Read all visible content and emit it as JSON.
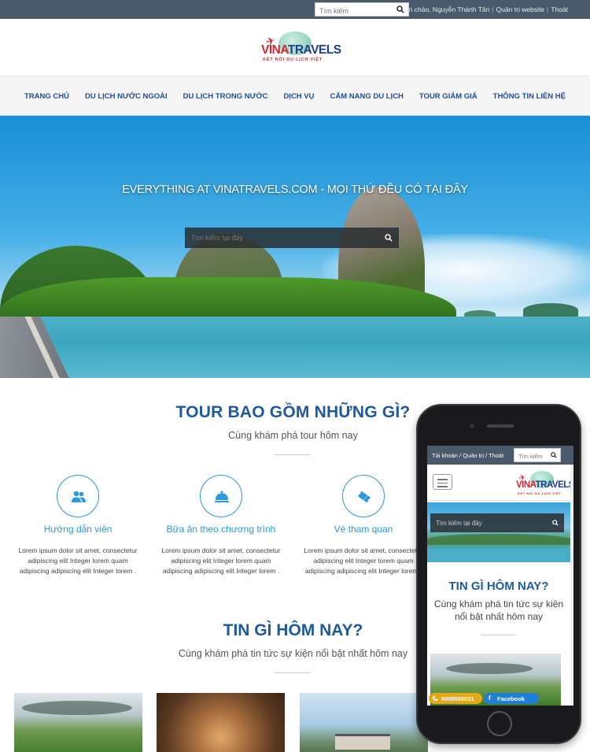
{
  "topbar": {
    "search_placeholder": "Tìm kiếm",
    "greeting": "Xin chào, Nguyễn Thành Tân",
    "admin_link": "Quản trị website",
    "logout_link": "Thoát"
  },
  "logo": {
    "brand_part1": "VINA",
    "brand_part2": "TRAVELS",
    "tagline": "KẾT NỐI DU LỊCH VIỆT"
  },
  "nav": {
    "items": [
      "TRANG CHỦ",
      "DU LỊCH NƯỚC NGOÀI",
      "DU LỊCH TRONG NƯỚC",
      "DỊCH VỤ",
      "CẨM NANG DU LỊCH",
      "TOUR GIẢM GIÁ",
      "THÔNG TIN LIÊN HỆ"
    ]
  },
  "hero": {
    "title": "EVERYTHING AT VINATRAVELS.COM - MỌI THỨ ĐỀU CÓ TẠI ĐÂY",
    "search_placeholder": "Tìm kiếm tại đây"
  },
  "tour": {
    "title": "TOUR BAO GỒM NHỮNG GÌ?",
    "subtitle": "Cùng khám phá tour hôm nay",
    "features": [
      {
        "icon": "users-icon",
        "title": "Hướng dẫn viên",
        "desc": "Lorem ipsum dolor sit amet, consectetur adipiscing elit Integer lorem quam adipiscing adipiscing elit Integer lorem ."
      },
      {
        "icon": "food-cloche-icon",
        "title": "Bữa ăn theo chương trình",
        "desc": "Lorem ipsum dolor sit amet, consectetur adipiscing elit Integer lorem quam adipiscing adipiscing elit Integer lorem ."
      },
      {
        "icon": "ticket-icon",
        "title": "Vé tham quan",
        "desc": "Lorem ipsum dolor sit amet, consectetur adipiscing elit Integer lorem quam adipiscing adipiscing elit Integer lorem ."
      }
    ]
  },
  "news": {
    "title": "TIN GÌ HÔM NAY?",
    "subtitle": "Cùng khám phá tin tức sự kiện nổi bật nhất hôm nay"
  },
  "mobile": {
    "top_links": "Tài khoản / Quản trị / Thoát",
    "search_placeholder": "Tìm kiếm",
    "hero_search_placeholder": "Tìm kiếm tại đây",
    "news_title": "TIN GÌ HÔM NAY?",
    "news_subtitle": "Cùng khám phá tin tức sự kiện nổi bật nhất hôm nay",
    "phone_button": "0000000031",
    "facebook_button": "Facebook"
  },
  "colors": {
    "topbar": "#4a5a6a",
    "nav_text": "#1f4d96",
    "heading": "#1e5aa0",
    "accent": "#2a9ad8",
    "phone_button": "#e6a817",
    "facebook_button": "#1f7fd6"
  }
}
